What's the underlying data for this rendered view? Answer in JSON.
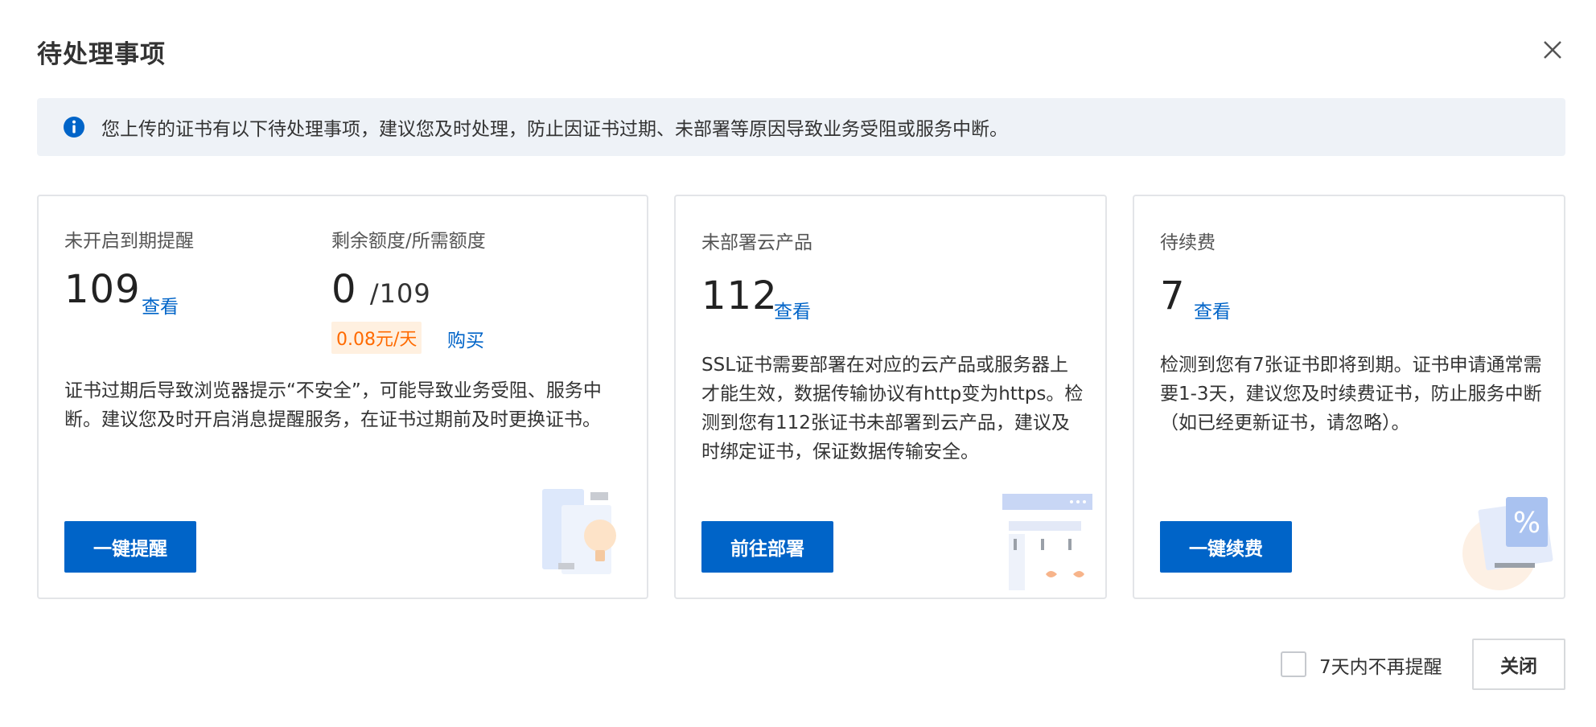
{
  "dialog": {
    "title": "待处理事项",
    "close_icon": "close-icon"
  },
  "notice": {
    "icon": "info-icon",
    "text": "您上传的证书有以下待处理事项，建议您及时处理，防止因证书过期、未部署等原因导致业务受阻或服务中断。"
  },
  "cards": {
    "reminder": {
      "label": "未开启到期提醒",
      "count": "109",
      "view_link": "查看",
      "quota_label": "剩余额度/所需额度",
      "quota_remaining": "0",
      "quota_sep": "/",
      "quota_required": "109",
      "price": "0.08元/天",
      "buy_link": "购买",
      "desc": "证书过期后导致浏览器提示“不安全”，可能导致业务受阻、服务中断。建议您及时开启消息提醒服务，在证书过期前及时更换证书。",
      "button": "一键提醒"
    },
    "deploy": {
      "label": "未部署云产品",
      "count": "112",
      "view_link": "查看",
      "desc": "SSL证书需要部署在对应的云产品或服务器上才能生效，数据传输协议有http变为https。检测到您有112张证书未部署到云产品，建议及时绑定证书，保证数据传输安全。",
      "button": "前往部署"
    },
    "renew": {
      "label": "待续费",
      "count": "7",
      "view_link": "查看",
      "desc": "检测到您有7张证书即将到期。证书申请通常需要1-3天，建议您及时续费证书，防止服务中断（如已经更新证书，请忽略）。",
      "button": "一键续费"
    }
  },
  "footer": {
    "checkbox_label": "7天内不再提醒",
    "checkbox_checked": false,
    "close_button": "关闭"
  },
  "colors": {
    "primary": "#0064c8",
    "link": "#0064c8",
    "price_text": "#ff6a00",
    "price_bg": "#fff0e0",
    "notice_bg": "#eef2f7"
  }
}
